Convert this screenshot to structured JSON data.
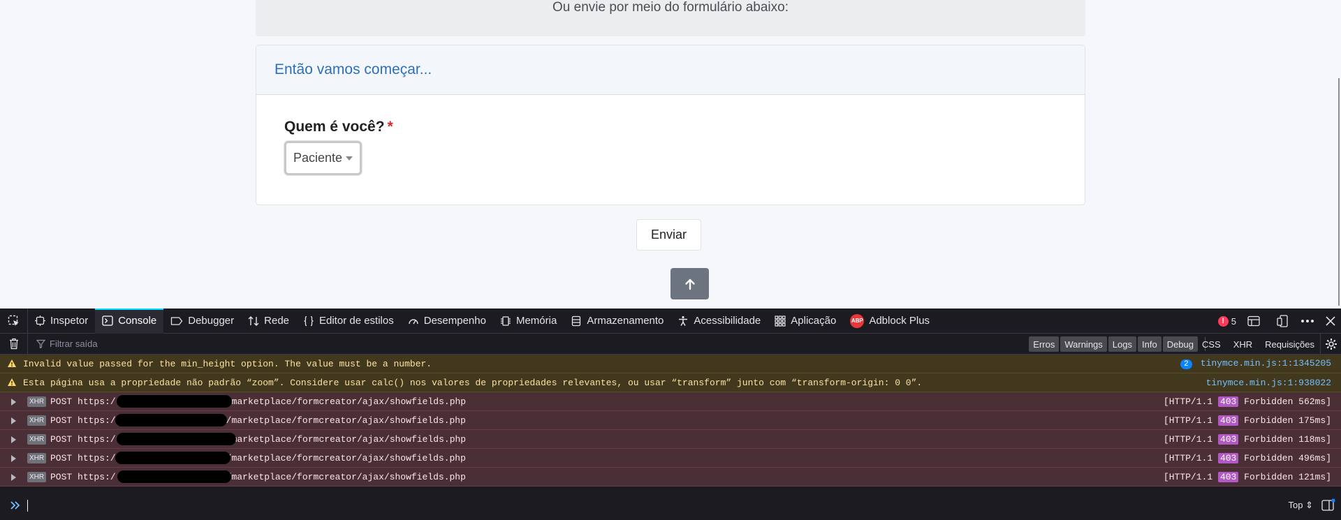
{
  "page": {
    "intro_text": "Ou envie por meio do formulário abaixo:",
    "card_title": "Então vamos começar...",
    "question_label": "Quem é você?",
    "required_mark": "*",
    "select_value": "Paciente",
    "submit_label": "Enviar"
  },
  "devtools": {
    "tabs": [
      {
        "label": "Inspetor",
        "icon": "inspector-icon"
      },
      {
        "label": "Console",
        "icon": "console-icon",
        "active": true
      },
      {
        "label": "Debugger",
        "icon": "debugger-icon"
      },
      {
        "label": "Rede",
        "icon": "network-icon"
      },
      {
        "label": "Editor de estilos",
        "icon": "style-editor-icon"
      },
      {
        "label": "Desempenho",
        "icon": "performance-icon"
      },
      {
        "label": "Memória",
        "icon": "memory-icon"
      },
      {
        "label": "Armazenamento",
        "icon": "storage-icon"
      },
      {
        "label": "Acessibilidade",
        "icon": "accessibility-icon"
      },
      {
        "label": "Aplicação",
        "icon": "application-icon"
      },
      {
        "label": "Adblock Plus",
        "icon": "adblock-plus-icon",
        "icon_text": "ABP"
      }
    ],
    "error_count": "5",
    "filter_placeholder": "Filtrar saída",
    "levels": [
      "Erros",
      "Warnings",
      "Logs",
      "Info",
      "Debug"
    ],
    "types": [
      "CSS",
      "XHR",
      "Requisições"
    ],
    "warnings": [
      {
        "text": "Invalid value passed for the min_height option. The value must be a number.",
        "repeat": "2",
        "source": "tinymce.min.js:1:1345205"
      },
      {
        "text": "Esta página usa a propriedade não padrão “zoom”. Considere usar calc() nos valores de propriedades relevantes, ou usar “transform” junto com “transform-origin: 0 0”.",
        "source": "tinymce.min.js:1:938022"
      }
    ],
    "requests": [
      {
        "badge": "XHR",
        "method": "POST",
        "url_start": "https:/",
        "url_end": "marketplace/formcreator/ajax/showfields.php",
        "status_prefix": "[HTTP/1.1",
        "code": "403",
        "status_suffix": "Forbidden 562ms]"
      },
      {
        "badge": "XHR",
        "method": "POST",
        "url_start": "https:/",
        "url_end": "/marketplace/formcreator/ajax/showfields.php",
        "status_prefix": "[HTTP/1.1",
        "code": "403",
        "status_suffix": "Forbidden 175ms]"
      },
      {
        "badge": "XHR",
        "method": "POST",
        "url_start": "https:/",
        "url_end": "marketplace/formcreator/ajax/showfields.php",
        "status_prefix": "[HTTP/1.1",
        "code": "403",
        "status_suffix": "Forbidden 118ms]"
      },
      {
        "badge": "XHR",
        "method": "POST",
        "url_start": "https:/",
        "url_end": "/marketplace/formcreator/ajax/showfields.php",
        "status_prefix": "[HTTP/1.1",
        "code": "403",
        "status_suffix": "Forbidden 496ms]"
      },
      {
        "badge": "XHR",
        "method": "POST",
        "url_start": "https:/",
        "url_end": "/marketplace/formcreator/ajax/showfields.php",
        "status_prefix": "[HTTP/1.1",
        "code": "403",
        "status_suffix": "Forbidden 121ms]"
      }
    ],
    "context_label": "Top ⇕"
  }
}
